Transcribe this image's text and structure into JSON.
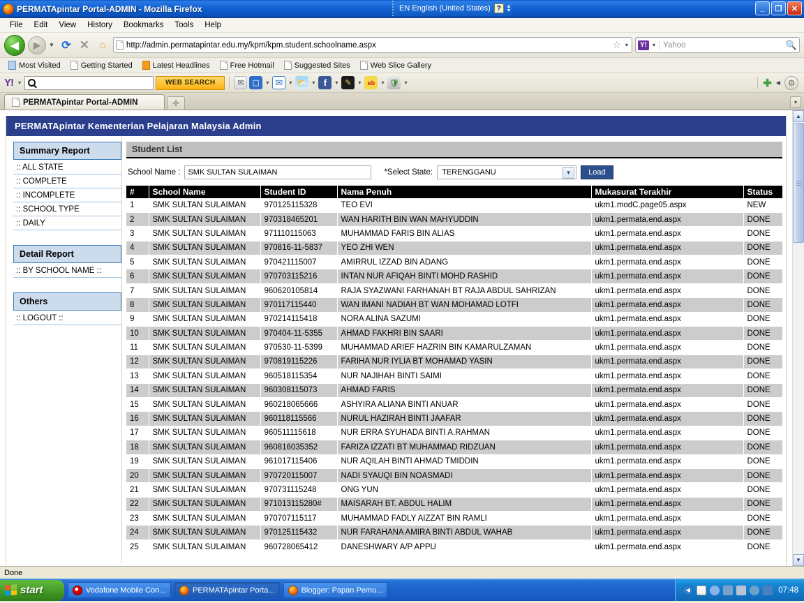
{
  "window": {
    "title": "PERMATApintar Portal-ADMIN - Mozilla Firefox",
    "minimize": "_",
    "maximize": "❐",
    "close": "✕",
    "language_indicator": "EN English (United States)",
    "language_help": "?"
  },
  "menubar": [
    {
      "label": "File"
    },
    {
      "label": "Edit"
    },
    {
      "label": "View"
    },
    {
      "label": "History"
    },
    {
      "label": "Bookmarks"
    },
    {
      "label": "Tools"
    },
    {
      "label": "Help"
    }
  ],
  "navbar": {
    "back_glyph": "◀",
    "forward_glyph": "▶",
    "dropdown_glyph": "▼",
    "reload_glyph": "⟳",
    "stop_glyph": "✕",
    "home_glyph": "⌂",
    "url": "http://admin.permatapintar.edu.my/kpm/kpm.student.schoolname.aspx",
    "star_glyph": "☆",
    "url_dropdown_glyph": "▾",
    "search_provider": "Y!",
    "search_placeholder": "Yahoo",
    "search_magnifier": "🔍"
  },
  "bookmarks": [
    {
      "label": "Most Visited",
      "icon": "folder-icon"
    },
    {
      "label": "Getting Started",
      "icon": "page-icon"
    },
    {
      "label": "Latest Headlines",
      "icon": "rss-icon"
    },
    {
      "label": "Free Hotmail",
      "icon": "page-icon"
    },
    {
      "label": "Suggested Sites",
      "icon": "page-icon"
    },
    {
      "label": "Web Slice Gallery",
      "icon": "page-icon"
    }
  ],
  "yahoo_toolbar": {
    "logo": "Y!",
    "dropdown_glyph": "▾",
    "search_value": "",
    "web_search_label": "WEB SEARCH",
    "icons": [
      {
        "name": "mail-envelope-icon",
        "glyph": "✉"
      },
      {
        "name": "bookmarks-book-icon",
        "glyph": "📘"
      },
      {
        "name": "mail-icon",
        "glyph": "✉"
      },
      {
        "name": "weather-icon",
        "glyph": "⛅"
      },
      {
        "name": "facebook-icon",
        "glyph": "f"
      },
      {
        "name": "messenger-icon",
        "glyph": "✎"
      },
      {
        "name": "ebay-icon",
        "glyph": "eb"
      },
      {
        "name": "antivirus-shield-icon",
        "glyph": "🛡"
      }
    ],
    "add_glyph": "✚",
    "collapse_glyph": "◀",
    "settings_glyph": "⚙"
  },
  "tabs": {
    "active_tab": "PERMATApintar Portal-ADMIN",
    "new_tab_glyph": "✛",
    "tab_list_glyph": "▾"
  },
  "app": {
    "header_title": "PERMATApintar Kementerian Pelajaran Malaysia Admin",
    "sidebar": {
      "summary_report_title": "Summary Report",
      "summary_items": [
        {
          "label": ":: ALL STATE"
        },
        {
          "label": ":: COMPLETE"
        },
        {
          "label": ":: INCOMPLETE"
        },
        {
          "label": ":: SCHOOL TYPE"
        },
        {
          "label": ":: DAILY"
        }
      ],
      "detail_report_title": "Detail Report",
      "detail_items": [
        {
          "label": ":: BY SCHOOL NAME ::"
        }
      ],
      "others_title": "Others",
      "others_items": [
        {
          "label": ":: LOGOUT ::"
        }
      ]
    },
    "section_title": "Student List",
    "form": {
      "school_name_label": "School Name :",
      "school_name_value": "SMK SULTAN SULAIMAN",
      "select_state_label": "*Select State:",
      "select_state_value": "TERENGGANU",
      "select_arrow_glyph": "▼",
      "load_button": "Load"
    },
    "table": {
      "columns": [
        "#",
        "School Name",
        "Student ID",
        "Nama Penuh",
        "Mukasurat Terakhir",
        "Status"
      ],
      "rows": [
        [
          "1",
          "SMK SULTAN SULAIMAN",
          "970125115328",
          "TEO EVI",
          "ukm1.modC.page05.aspx",
          "NEW"
        ],
        [
          "2",
          "SMK SULTAN SULAIMAN",
          "970318465201",
          "WAN HARITH BIN WAN MAHYUDDIN",
          "ukm1.permata.end.aspx",
          "DONE"
        ],
        [
          "3",
          "SMK SULTAN SULAIMAN",
          "971110115063",
          "MUHAMMAD FARIS BIN ALIAS",
          "ukm1.permata.end.aspx",
          "DONE"
        ],
        [
          "4",
          "SMK SULTAN SULAIMAN",
          "970816-11-5837",
          "YEO ZHI WEN",
          "ukm1.permata.end.aspx",
          "DONE"
        ],
        [
          "5",
          "SMK SULTAN SULAIMAN",
          "970421115007",
          "AMIRRUL IZZAD BIN ADANG",
          "ukm1.permata.end.aspx",
          "DONE"
        ],
        [
          "6",
          "SMK SULTAN SULAIMAN",
          "970703115216",
          "INTAN NUR AFIQAH BINTI MOHD RASHID",
          "ukm1.permata.end.aspx",
          "DONE"
        ],
        [
          "7",
          "SMK SULTAN SULAIMAN",
          "960620105814",
          "RAJA SYAZWANI FARHANAH BT RAJA ABDUL SAHRIZAN",
          "ukm1.permata.end.aspx",
          "DONE"
        ],
        [
          "8",
          "SMK SULTAN SULAIMAN",
          "970117115440",
          "WAN IMANI NADIAH BT WAN MOHAMAD LOTFI",
          "ukm1.permata.end.aspx",
          "DONE"
        ],
        [
          "9",
          "SMK SULTAN SULAIMAN",
          "970214115418",
          "NORA ALINA SAZUMI",
          "ukm1.permata.end.aspx",
          "DONE"
        ],
        [
          "10",
          "SMK SULTAN SULAIMAN",
          "970404-11-5355",
          "AHMAD FAKHRI BIN SAARI",
          "ukm1.permata.end.aspx",
          "DONE"
        ],
        [
          "11",
          "SMK SULTAN SULAIMAN",
          "970530-11-5399",
          "MUHAMMAD ARIEF HAZRIN BIN KAMARULZAMAN",
          "ukm1.permata.end.aspx",
          "DONE"
        ],
        [
          "12",
          "SMK SULTAN SULAIMAN",
          "970819115226",
          "FARIHA NUR IYLIA BT MOHAMAD YASIN",
          "ukm1.permata.end.aspx",
          "DONE"
        ],
        [
          "13",
          "SMK SULTAN SULAIMAN",
          "960518115354",
          "NUR NAJIHAH BINTI SAIMI",
          "ukm1.permata.end.aspx",
          "DONE"
        ],
        [
          "14",
          "SMK SULTAN SULAIMAN",
          "960308115073",
          "AHMAD FARIS",
          "ukm1.permata.end.aspx",
          "DONE"
        ],
        [
          "15",
          "SMK SULTAN SULAIMAN",
          "960218065666",
          "ASHYIRA ALIANA BINTI ANUAR",
          "ukm1.permata.end.aspx",
          "DONE"
        ],
        [
          "16",
          "SMK SULTAN SULAIMAN",
          "960118115566",
          "NURUL HAZIRAH BINTI JAAFAR",
          "ukm1.permata.end.aspx",
          "DONE"
        ],
        [
          "17",
          "SMK SULTAN SULAIMAN",
          "960511115618",
          "NUR ERRA SYUHADA BINTI A.RAHMAN",
          "ukm1.permata.end.aspx",
          "DONE"
        ],
        [
          "18",
          "SMK SULTAN SULAIMAN",
          "960816035352",
          "FARIZA IZZATI BT MUHAMMAD RIDZUAN",
          "ukm1.permata.end.aspx",
          "DONE"
        ],
        [
          "19",
          "SMK SULTAN SULAIMAN",
          "961017115406",
          "NUR AQILAH BINTI AHMAD TMIDDIN",
          "ukm1.permata.end.aspx",
          "DONE"
        ],
        [
          "20",
          "SMK SULTAN SULAIMAN",
          "970720115007",
          "NADI SYAUQI BIN NOASMADI",
          "ukm1.permata.end.aspx",
          "DONE"
        ],
        [
          "21",
          "SMK SULTAN SULAIMAN",
          "970731115248",
          "ONG YUN",
          "ukm1.permata.end.aspx",
          "DONE"
        ],
        [
          "22",
          "SMK SULTAN SULAIMAN",
          "971013115280#",
          "MAISARAH BT. ABDUL HALIM",
          "ukm1.permata.end.aspx",
          "DONE"
        ],
        [
          "23",
          "SMK SULTAN SULAIMAN",
          "970707115117",
          "MUHAMMAD FADLY AIZZAT BIN RAMLI",
          "ukm1.permata.end.aspx",
          "DONE"
        ],
        [
          "24",
          "SMK SULTAN SULAIMAN",
          "970125115432",
          "NUR FARAHANA AMIRA BINTI ABDUL WAHAB",
          "ukm1.permata.end.aspx",
          "DONE"
        ],
        [
          "25",
          "SMK SULTAN SULAIMAN",
          "960728065412",
          "DANESHWARY A/P APPU",
          "ukm1.permata.end.aspx",
          "DONE"
        ]
      ]
    }
  },
  "scrollbar": {
    "up_glyph": "▲",
    "down_glyph": "▼"
  },
  "statusbar": {
    "text": "Done"
  },
  "taskbar": {
    "start_label": "start",
    "items": [
      {
        "label": "Vodafone Mobile Con...",
        "icon": "vodafone-icon",
        "active": false
      },
      {
        "label": "PERMATApintar Porta...",
        "icon": "firefox-icon",
        "active": true
      },
      {
        "label": "Blogger: Papan Pemu...",
        "icon": "firefox-icon",
        "active": false
      }
    ],
    "tray_chevron": "◀",
    "tray_icons": [
      {
        "name": "network-meter-icon",
        "color": "#cc2222"
      },
      {
        "name": "search-magnifier-icon",
        "color": "#8ab4e8"
      },
      {
        "name": "safely-remove-icon",
        "color": "#7aa0cc"
      },
      {
        "name": "printer-icon",
        "color": "#b6c4d4"
      },
      {
        "name": "clock-sync-icon",
        "color": "#6ea0c8"
      },
      {
        "name": "display-icon",
        "color": "#4a7fc0"
      }
    ],
    "clock": "07:48"
  },
  "colors": {
    "titlebar_blue": "#1464d4",
    "app_header_navy": "#2b3f8c",
    "panel_head_blue": "#cddcec",
    "table_header_black": "#000000",
    "row_alt_gray": "#cccccc",
    "load_button_navy": "#2b4f8c",
    "accent_yellow": "#fcb315"
  }
}
